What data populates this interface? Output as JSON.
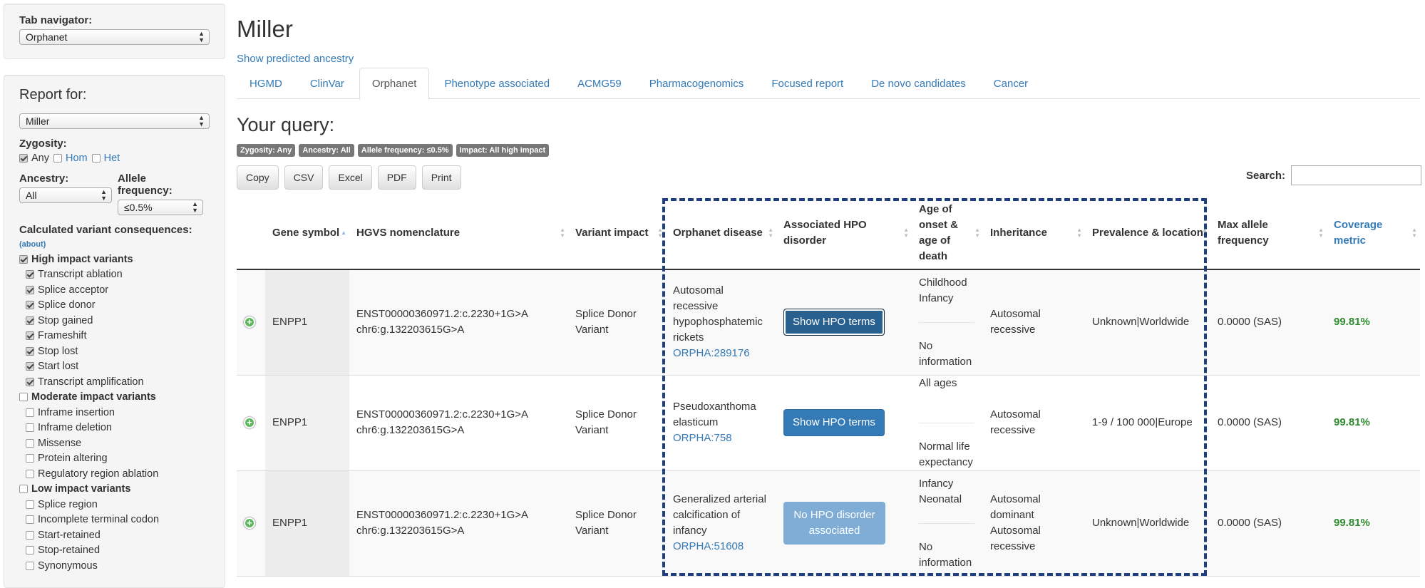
{
  "sidebar": {
    "tab_navigator": {
      "label": "Tab navigator:",
      "value": "Orphanet"
    },
    "report": {
      "title": "Report for:",
      "value": "Miller",
      "zygosity": {
        "label": "Zygosity:",
        "options": [
          {
            "label": "Any",
            "checked": true
          },
          {
            "label": "Hom",
            "checked": false
          },
          {
            "label": "Het",
            "checked": false
          }
        ]
      },
      "ancestry": {
        "label": "Ancestry:",
        "value": "All"
      },
      "allele_frequency": {
        "label": "Allele frequency:",
        "value": "≤0.5%"
      },
      "consequences": {
        "label": "Calculated variant consequences:",
        "about": "(about)",
        "items": [
          {
            "label": "High impact variants",
            "group": true,
            "checked": true
          },
          {
            "label": "Transcript ablation",
            "group": false,
            "checked": true
          },
          {
            "label": "Splice acceptor",
            "group": false,
            "checked": true
          },
          {
            "label": "Splice donor",
            "group": false,
            "checked": true
          },
          {
            "label": "Stop gained",
            "group": false,
            "checked": true
          },
          {
            "label": "Frameshift",
            "group": false,
            "checked": true
          },
          {
            "label": "Stop lost",
            "group": false,
            "checked": true
          },
          {
            "label": "Start lost",
            "group": false,
            "checked": true
          },
          {
            "label": "Transcript amplification",
            "group": false,
            "checked": true
          },
          {
            "label": "Moderate impact variants",
            "group": true,
            "checked": false
          },
          {
            "label": "Inframe insertion",
            "group": false,
            "checked": false
          },
          {
            "label": "Inframe deletion",
            "group": false,
            "checked": false
          },
          {
            "label": "Missense",
            "group": false,
            "checked": false
          },
          {
            "label": "Protein altering",
            "group": false,
            "checked": false
          },
          {
            "label": "Regulatory region ablation",
            "group": false,
            "checked": false
          },
          {
            "label": "Low impact variants",
            "group": true,
            "checked": false
          },
          {
            "label": "Splice region",
            "group": false,
            "checked": false
          },
          {
            "label": "Incomplete terminal codon",
            "group": false,
            "checked": false
          },
          {
            "label": "Start-retained",
            "group": false,
            "checked": false
          },
          {
            "label": "Stop-retained",
            "group": false,
            "checked": false
          },
          {
            "label": "Synonymous",
            "group": false,
            "checked": false
          }
        ]
      }
    }
  },
  "main": {
    "title": "Miller",
    "ancestry_link": "Show predicted ancestry",
    "tabs": [
      {
        "label": "HGMD",
        "active": false
      },
      {
        "label": "ClinVar",
        "active": false
      },
      {
        "label": "Orphanet",
        "active": true
      },
      {
        "label": "Phenotype associated",
        "active": false
      },
      {
        "label": "ACMG59",
        "active": false
      },
      {
        "label": "Pharmacogenomics",
        "active": false
      },
      {
        "label": "Focused report",
        "active": false
      },
      {
        "label": "De novo candidates",
        "active": false
      },
      {
        "label": "Cancer",
        "active": false
      }
    ],
    "query_heading": "Your query:",
    "badges": [
      "Zygosity: Any",
      "Ancestry: All",
      "Allele frequency: ≤0.5%",
      "Impact: All high impact"
    ],
    "buttons": [
      "Copy",
      "CSV",
      "Excel",
      "PDF",
      "Print"
    ],
    "search": {
      "label": "Search:",
      "value": ""
    },
    "table": {
      "headers": [
        "Gene symbol",
        "HGVS nomenclature",
        "Variant impact",
        "Orphanet disease",
        "Associated HPO disorder",
        "Age of onset & age of death",
        "Inheritance",
        "Prevalence & location",
        "Max allele frequency",
        "Coverage metric"
      ],
      "rows": [
        {
          "gene": "ENPP1",
          "hgvs1": "ENST00000360971.2:c.2230+1G>A",
          "hgvs2": "chr6:g.132203615G>A",
          "impact": "Splice Donor Variant",
          "disease": "Autosomal recessive hypophosphatemic rickets",
          "orpha": "ORPHA:289176",
          "hpo": "Show HPO terms",
          "age_onset": "Childhood Infancy",
          "age_death": "No information",
          "inheritance": "Autosomal recessive",
          "prevalence": "Unknown|Worldwide",
          "max_af": "0.0000 (SAS)",
          "coverage": "99.81%"
        },
        {
          "gene": "ENPP1",
          "hgvs1": "ENST00000360971.2:c.2230+1G>A",
          "hgvs2": "chr6:g.132203615G>A",
          "impact": "Splice Donor Variant",
          "disease": "Pseudoxanthoma elasticum",
          "orpha": "ORPHA:758",
          "hpo": "Show HPO terms",
          "age_onset": "All ages",
          "age_death": "Normal life expectancy",
          "inheritance": "Autosomal recessive",
          "prevalence": "1-9 / 100 000|Europe",
          "max_af": "0.0000 (SAS)",
          "coverage": "99.81%"
        },
        {
          "gene": "ENPP1",
          "hgvs1": "ENST00000360971.2:c.2230+1G>A",
          "hgvs2": "chr6:g.132203615G>A",
          "impact": "Splice Donor Variant",
          "disease": "Generalized arterial calcification of infancy",
          "orpha": "ORPHA:51608",
          "hpo": "No HPO disorder associated",
          "age_onset": "Infancy Neonatal",
          "age_death": "No information",
          "inheritance": "Autosomal dominant Autosomal recessive",
          "prevalence": "Unknown|Worldwide",
          "max_af": "0.0000 (SAS)",
          "coverage": "99.81%"
        }
      ]
    }
  },
  "colors": {
    "link": "#337ab7",
    "coverage_green": "#2e8b2e",
    "badge_gray": "#777777",
    "highlight_box": "#1f3f80"
  }
}
